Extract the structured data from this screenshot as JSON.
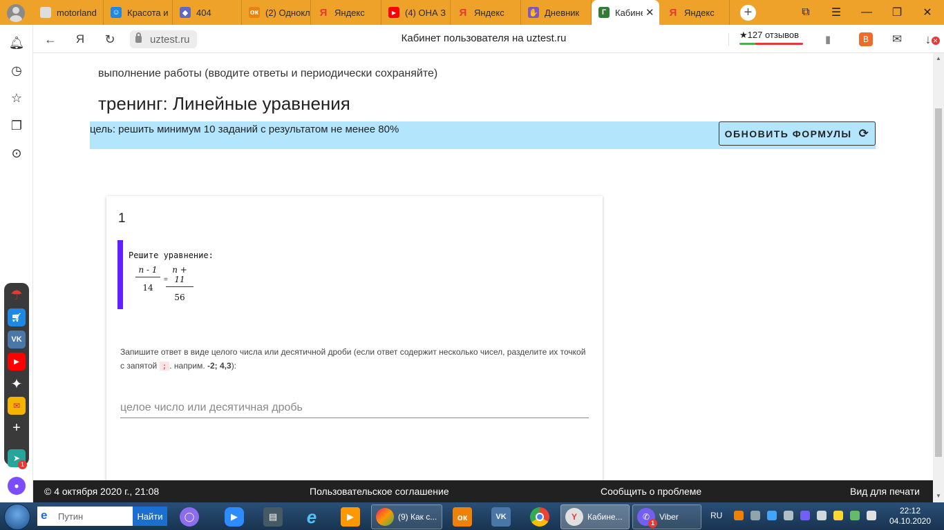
{
  "browser": {
    "tabs": [
      {
        "label": "motorland",
        "icon": "motorland-favicon",
        "color": "#e0e0e0"
      },
      {
        "label": "Красота и",
        "icon": "krasota-favicon",
        "color": "#1e88e5"
      },
      {
        "label": "404",
        "icon": "404-favicon",
        "color": "#5c6bc0"
      },
      {
        "label": "(2) Однокл",
        "icon": "odnoklassniki-icon",
        "color": "#ee8208"
      },
      {
        "label": "Яндекс",
        "icon": "yandex-icon",
        "color": "#e53935"
      },
      {
        "label": "(4) ОНА З",
        "icon": "youtube-icon",
        "color": "#ff0000"
      },
      {
        "label": "Яндекс",
        "icon": "yandex-icon",
        "color": "#e53935"
      },
      {
        "label": "Дневник",
        "icon": "dnevnik-icon",
        "color": "#7e57c2"
      },
      {
        "label": "Кабинет",
        "icon": "uztest-favicon",
        "color": "#2e7d32",
        "active": true
      },
      {
        "label": "Яндекс",
        "icon": "yandex-icon",
        "color": "#e53935"
      }
    ],
    "url": "uztest.ru",
    "page_title": "Кабинет пользователя на uztest.ru",
    "reviews": "★127 отзывов",
    "accent_color": "#efa229"
  },
  "page": {
    "subtitle": "выполнение работы (вводите ответы и периодически сохраняйте)",
    "heading": "тренинг: Линейные уравнения",
    "goal": "цель: решить минимум 10 заданий с результатом не менее 80%",
    "refresh_button": "ОБНОВИТЬ ФОРМУЛЫ",
    "goal_bg_color": "#b3e5fc",
    "question": {
      "number": "1",
      "prompt": "Решите уравнение:",
      "left_num": "n - 1",
      "left_den": "14",
      "equals": "=",
      "right_num": "n + 11",
      "right_den": "56",
      "instruction_start": "Запишите ответ в виде целого числа или десятичной дроби (если ответ содержит несколько чисел, разделите их точкой с запятой",
      "separator": ";",
      "instruction_mid": ". наприм.",
      "example": "-2; 4,3",
      "instruction_end": "):",
      "answer_placeholder": "целое число или десятичная дробь",
      "accent_color": "#651fff"
    }
  },
  "footer": {
    "copyright": "© 4 октября 2020 г., 21:08",
    "agreement": "Пользовательское соглашение",
    "report": "Сообщить о проблеме",
    "print": "Вид для печати"
  },
  "taskbar": {
    "search_placeholder": "Путин",
    "search_button": "Найти",
    "windows": [
      {
        "label": "(9) Как с...",
        "icon": "photos-icon"
      },
      {
        "label": "Кабине...",
        "icon": "yandex-browser-icon"
      },
      {
        "label": "Viber",
        "icon": "viber-icon",
        "badge": "1"
      }
    ],
    "lang": "RU",
    "time": "22:12",
    "date": "04.10.2020"
  },
  "sidebar": {
    "viber_badge": "1"
  }
}
